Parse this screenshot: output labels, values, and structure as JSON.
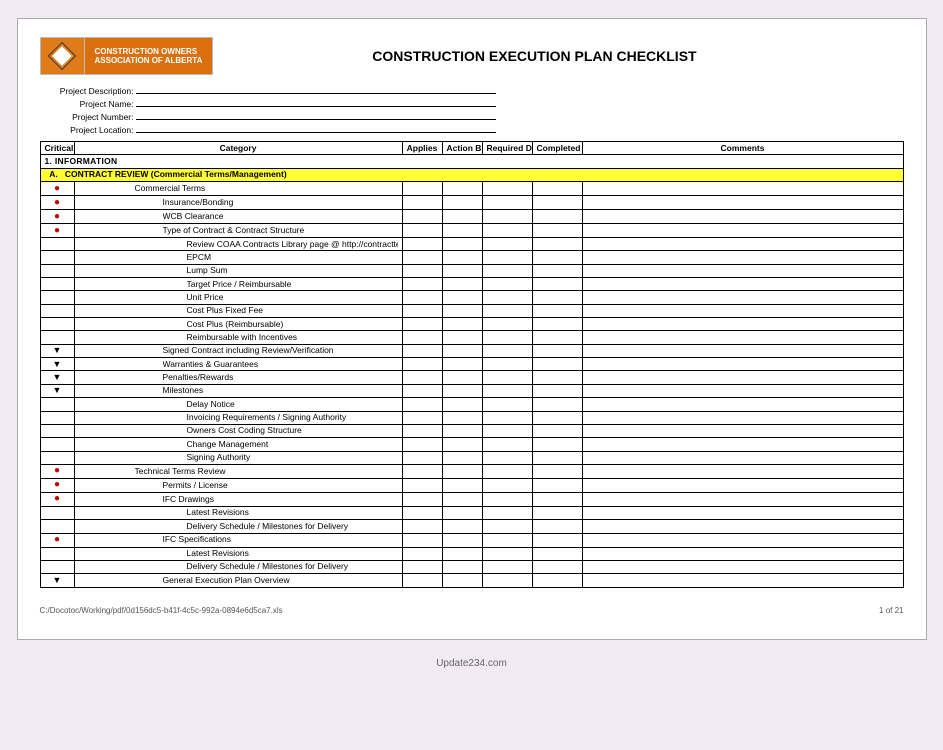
{
  "logo": {
    "line1": "CONSTRUCTION OWNERS",
    "line2": "ASSOCIATION OF ALBERTA"
  },
  "title": "CONSTRUCTION EXECUTION PLAN CHECKLIST",
  "meta": [
    {
      "label": "Project Description:"
    },
    {
      "label": "Project Name:"
    },
    {
      "label": "Project Number:"
    },
    {
      "label": "Project Location:"
    }
  ],
  "columns": {
    "critical": "Critical Level",
    "category": "Category",
    "applies": "Applies",
    "action_by": "Action By",
    "required_date": "Required Date",
    "completed": "Completed",
    "comments": "Comments"
  },
  "section": {
    "title": "1. INFORMATION"
  },
  "subsection": {
    "label": "A.",
    "title": "CONTRACT REVIEW (Commercial Terms/Management)"
  },
  "rows": [
    {
      "crit": "dot",
      "indent": 2,
      "text": "Commercial Terms"
    },
    {
      "crit": "dot",
      "indent": 3,
      "text": "Insurance/Bonding"
    },
    {
      "crit": "dot",
      "indent": 3,
      "text": "WCB Clearance"
    },
    {
      "crit": "dot",
      "indent": 3,
      "text": "Type of Contract & Contract Structure"
    },
    {
      "crit": "",
      "indent": 4,
      "text": "Review COAA Contracts Library page @ http://contractterms.coaa.ab.ca/library.asp"
    },
    {
      "crit": "",
      "indent": 4,
      "text": "EPCM"
    },
    {
      "crit": "",
      "indent": 4,
      "text": "Lump Sum"
    },
    {
      "crit": "",
      "indent": 4,
      "text": "Target Price / Reimbursable"
    },
    {
      "crit": "",
      "indent": 4,
      "text": "Unit Price"
    },
    {
      "crit": "",
      "indent": 4,
      "text": "Cost Plus Fixed Fee"
    },
    {
      "crit": "",
      "indent": 4,
      "text": "Cost Plus (Reimbursable)"
    },
    {
      "crit": "",
      "indent": 4,
      "text": "Reimbursable with Incentives"
    },
    {
      "crit": "chev",
      "indent": 3,
      "text": "Signed Contract including Review/Verification"
    },
    {
      "crit": "chev",
      "indent": 3,
      "text": "Warranties & Guarantees"
    },
    {
      "crit": "chev",
      "indent": 3,
      "text": "Penalties/Rewards"
    },
    {
      "crit": "chev",
      "indent": 3,
      "text": "Milestones"
    },
    {
      "crit": "",
      "indent": 4,
      "text": "Delay Notice"
    },
    {
      "crit": "",
      "indent": 4,
      "text": "Invoicing Requirements / Signing Authority"
    },
    {
      "crit": "",
      "indent": 4,
      "text": "Owners Cost Coding Structure"
    },
    {
      "crit": "",
      "indent": 4,
      "text": "Change Management"
    },
    {
      "crit": "",
      "indent": 4,
      "text": "Signing Authority"
    },
    {
      "crit": "dot",
      "indent": 2,
      "text": "Technical Terms Review"
    },
    {
      "crit": "dot",
      "indent": 3,
      "text": "Permits / License"
    },
    {
      "crit": "dot",
      "indent": 3,
      "text": "IFC Drawings"
    },
    {
      "crit": "",
      "indent": 4,
      "text": "Latest Revisions"
    },
    {
      "crit": "",
      "indent": 4,
      "text": "Delivery Schedule / Milestones for Delivery"
    },
    {
      "crit": "dot",
      "indent": 3,
      "text": "IFC Specifications"
    },
    {
      "crit": "",
      "indent": 4,
      "text": "Latest Revisions"
    },
    {
      "crit": "",
      "indent": 4,
      "text": "Delivery Schedule / Milestones for Delivery"
    },
    {
      "crit": "chev",
      "indent": 3,
      "text": "General Execution Plan Overview"
    }
  ],
  "footer": {
    "path": "C:/Docotoc/Working/pdf/0d156dc5-b41f-4c5c-992a-0894e6d5ca7.xls",
    "page": "1 of 21"
  },
  "credit": "Update234.com"
}
